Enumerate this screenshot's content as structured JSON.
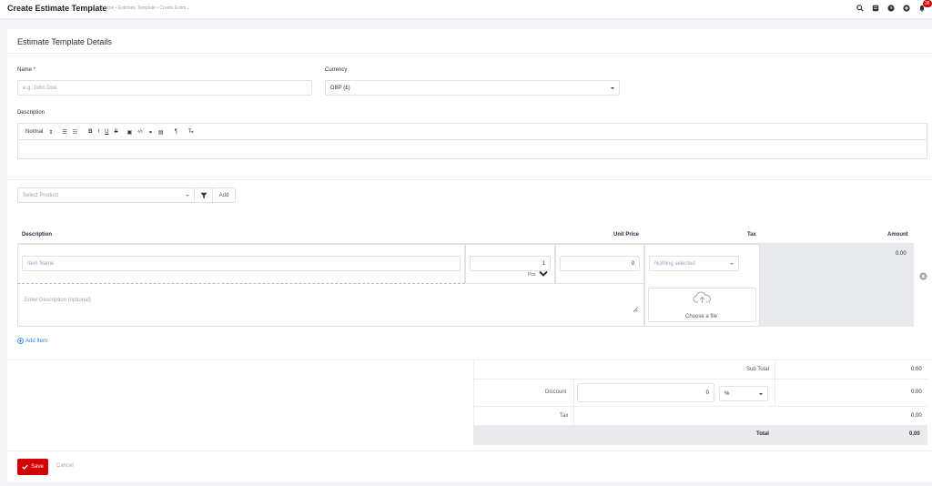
{
  "header": {
    "page_title": "Create Estimate Template",
    "breadcrumb": "Home • Estimate Template • Create Estim...",
    "notification_count": "36"
  },
  "card": {
    "title": "Estimate Template Details"
  },
  "form": {
    "name_label": "Name",
    "name_required": "*",
    "name_placeholder": "e.g. John Doe",
    "currency_label": "Currency",
    "currency_value": "GBP (£)",
    "description_label": "Description",
    "editor_format": "Normal"
  },
  "product": {
    "select_placeholder": "Select Product",
    "add_label": "Add"
  },
  "items_table": {
    "headers": {
      "description": "Description",
      "unit_price": "Unit Price",
      "tax": "Tax",
      "amount": "Amount"
    },
    "row": {
      "item_name_placeholder": "Item Name",
      "quantity": "1",
      "unit": "Pcs",
      "unit_price": "0",
      "tax_placeholder": "Nothing selected",
      "amount": "0.00",
      "description_placeholder": "Enter Description (optional)",
      "file_label": "Choose a file"
    },
    "add_item_label": "Add Item"
  },
  "totals": {
    "sub_total_label": "Sub Total",
    "sub_total_value": "0.00",
    "discount_label": "Discount",
    "discount_input": "0",
    "discount_type": "%",
    "discount_value": "0.00",
    "tax_label": "Tax",
    "tax_value": "0.00",
    "total_label": "Total",
    "total_value": "0.00"
  },
  "actions": {
    "save_label": "Save",
    "cancel_label": "Cancel"
  },
  "colors": {
    "accent_red": "#d30000",
    "link_blue": "#1d82f5",
    "grey_cell": "#e8eaed"
  }
}
